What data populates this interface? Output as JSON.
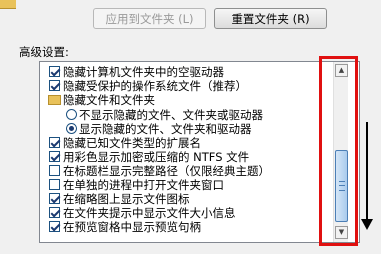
{
  "buttons": {
    "apply": "应用到文件夹 (L)",
    "reset": "重置文件夹 (R)"
  },
  "advanced_label": "高级设置:",
  "items": [
    {
      "kind": "checkbox",
      "checked": true,
      "label": "隐藏计算机文件夹中的空驱动器"
    },
    {
      "kind": "checkbox",
      "checked": true,
      "label": "隐藏受保护的操作系统文件（推荐）"
    },
    {
      "kind": "folder",
      "label": "隐藏文件和文件夹"
    },
    {
      "kind": "radio",
      "checked": false,
      "label": "不显示隐藏的文件、文件夹或驱动器"
    },
    {
      "kind": "radio",
      "checked": true,
      "label": "显示隐藏的文件、文件夹和驱动器"
    },
    {
      "kind": "checkbox",
      "checked": true,
      "label": "隐藏已知文件类型的扩展名"
    },
    {
      "kind": "checkbox",
      "checked": true,
      "label": "用彩色显示加密或压缩的 NTFS 文件"
    },
    {
      "kind": "checkbox",
      "checked": false,
      "label": "在标题栏显示完整路径（仅限经典主题）"
    },
    {
      "kind": "checkbox",
      "checked": false,
      "label": "在单独的进程中打开文件夹窗口"
    },
    {
      "kind": "checkbox",
      "checked": true,
      "label": "在缩略图上显示文件图标"
    },
    {
      "kind": "checkbox",
      "checked": true,
      "label": "在文件夹提示中显示文件大小信息"
    },
    {
      "kind": "checkbox",
      "checked": true,
      "label": "在预览窗格中显示预览句柄"
    }
  ],
  "icons": {
    "scroll_up": "scroll-up-arrow-icon",
    "scroll_down": "scroll-down-arrow-icon",
    "folder": "folder-icon",
    "annotation_arrow": "down-arrow-icon"
  },
  "colors": {
    "highlight_box": "#e01010",
    "scroll_thumb": "#a9cbed"
  }
}
